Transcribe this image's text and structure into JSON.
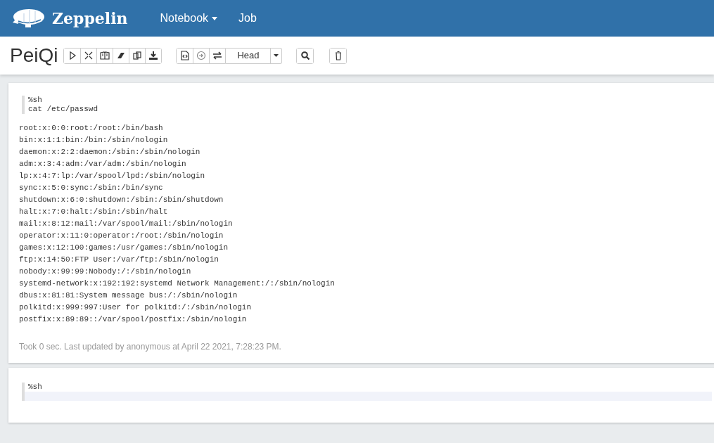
{
  "navbar": {
    "brand": "Zeppelin",
    "menu": [
      {
        "label": "Notebook",
        "dropdown": true
      },
      {
        "label": "Job",
        "dropdown": false
      }
    ]
  },
  "note": {
    "title": "PeiQi",
    "head_selector": "Head"
  },
  "paragraphs": [
    {
      "code_lines": [
        "%sh",
        "cat /etc/passwd"
      ],
      "output_lines": [
        "root:x:0:0:root:/root:/bin/bash",
        "bin:x:1:1:bin:/bin:/sbin/nologin",
        "daemon:x:2:2:daemon:/sbin:/sbin/nologin",
        "adm:x:3:4:adm:/var/adm:/sbin/nologin",
        "lp:x:4:7:lp:/var/spool/lpd:/sbin/nologin",
        "sync:x:5:0:sync:/sbin:/bin/sync",
        "shutdown:x:6:0:shutdown:/sbin:/sbin/shutdown",
        "halt:x:7:0:halt:/sbin:/sbin/halt",
        "mail:x:8:12:mail:/var/spool/mail:/sbin/nologin",
        "operator:x:11:0:operator:/root:/sbin/nologin",
        "games:x:12:100:games:/usr/games:/sbin/nologin",
        "ftp:x:14:50:FTP User:/var/ftp:/sbin/nologin",
        "nobody:x:99:99:Nobody:/:/sbin/nologin",
        "systemd-network:x:192:192:systemd Network Management:/:/sbin/nologin",
        "dbus:x:81:81:System message bus:/:/sbin/nologin",
        "polkitd:x:999:997:User for polkitd:/:/sbin/nologin",
        "postfix:x:89:89::/var/spool/postfix:/sbin/nologin"
      ],
      "status": "Took 0 sec. Last updated by anonymous at April 22 2021, 7:28:23 PM."
    },
    {
      "code_lines": [
        "%sh"
      ],
      "active_empty_line": true
    }
  ]
}
